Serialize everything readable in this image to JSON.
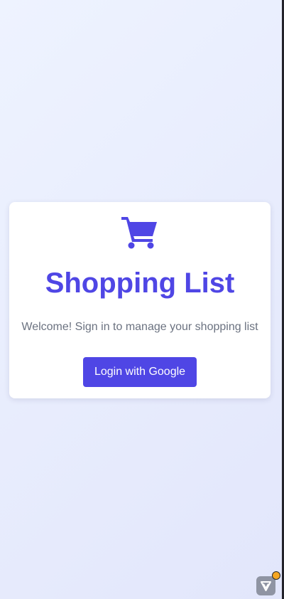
{
  "app": {
    "title": "Shopping List",
    "welcome_text": "Welcome! Sign in to manage your shopping list",
    "login_label": "Login with Google"
  },
  "icons": {
    "main": "shopping-cart-icon",
    "floating": "devtools-logo-icon",
    "badge": "notification-dot-icon"
  },
  "colors": {
    "accent": "#4f46e5",
    "subtitle": "#6b7280",
    "card": "#ffffff",
    "background_start": "#eef3ff",
    "background_end": "#e2e6fb",
    "badge": "#f5a623"
  }
}
